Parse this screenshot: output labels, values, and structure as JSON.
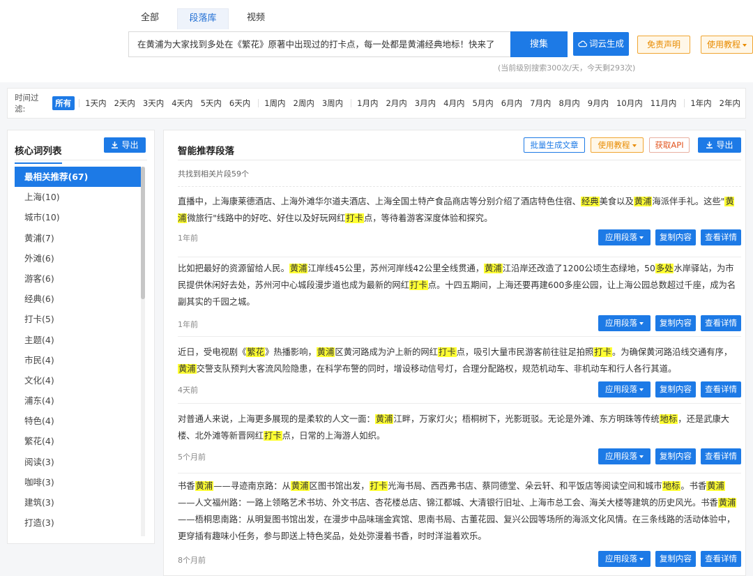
{
  "tabs": [
    {
      "label": "全部"
    },
    {
      "label": "段落库"
    },
    {
      "label": "视频"
    }
  ],
  "search": {
    "value": "在黄浦为大家找到多处在《繁花》原著中出现过的打卡点，每一处都是黄浦经典地标！快来了",
    "button": "搜集",
    "cloud_button": "词云生成",
    "disclaimer": "免责声明",
    "tutorial": "使用教程",
    "quota": "(当前级别搜索300次/天，今天剩293次)"
  },
  "filter": {
    "label": "时间过滤:",
    "options": [
      "所有",
      "1天内",
      "2天内",
      "3天内",
      "4天内",
      "5天内",
      "6天内",
      "1周内",
      "2周内",
      "3周内",
      "1月内",
      "2月内",
      "3月内",
      "4月内",
      "5月内",
      "6月内",
      "7月内",
      "8月内",
      "9月内",
      "10月内",
      "11月内",
      "1年内",
      "2年内"
    ]
  },
  "left": {
    "title": "核心词列表",
    "export": "导出",
    "keywords": [
      "最相关推荐(67)",
      "上海(10)",
      "城市(10)",
      "黄浦(7)",
      "外滩(6)",
      "游客(6)",
      "经典(6)",
      "打卡(5)",
      "主题(4)",
      "市民(4)",
      "文化(4)",
      "浦东(4)",
      "特色(4)",
      "繁花(4)",
      "阅读(3)",
      "咖啡(3)",
      "建筑(3)",
      "打造(3)"
    ]
  },
  "right": {
    "title": "智能推荐段落",
    "batch": "批量生成文章",
    "tutorial": "使用教程",
    "api": "获取API",
    "export": "导出",
    "count": "共找到相关片段59个",
    "actions": {
      "apply": "应用段落",
      "copy": "复制内容",
      "detail": "查看详情"
    },
    "cards": [
      {
        "time": "1年前",
        "segments": [
          {
            "t": "直播中，上海康莱德酒店、上海外滩华尔道夫酒店、上海全国土特产食品商店等分别介绍了酒店特色住宿、"
          },
          {
            "t": "经典",
            "h": true
          },
          {
            "t": "美食以及"
          },
          {
            "t": "黄浦",
            "h": true
          },
          {
            "t": "海派伴手礼。这些\""
          },
          {
            "t": "黄浦",
            "h": true
          },
          {
            "t": "微旅行\"线路中的好吃、好住以及好玩网红"
          },
          {
            "t": "打卡",
            "h": true
          },
          {
            "t": "点，等待着游客深度体验和探究。"
          }
        ]
      },
      {
        "time": "1年前",
        "segments": [
          {
            "t": "比如把最好的资源留给人民。"
          },
          {
            "t": "黄浦",
            "h": true
          },
          {
            "t": "江岸线45公里，苏州河岸线42公里全线贯通，"
          },
          {
            "t": "黄浦",
            "h": true
          },
          {
            "t": "江沿岸还改造了1200公顷生态绿地，50"
          },
          {
            "t": "多处",
            "h": true
          },
          {
            "t": "水岸驿站，为市民提供休闲好去处，苏州河中心城段漫步道也成为最新的网红"
          },
          {
            "t": "打卡",
            "h": true
          },
          {
            "t": "点。十四五期间，上海还要再建600多座公园，让上海公园总数超过千座，成为名副其实的千园之城。"
          }
        ]
      },
      {
        "time": "4天前",
        "segments": [
          {
            "t": "近日，受电视剧《"
          },
          {
            "t": "繁花",
            "h": true
          },
          {
            "t": "》热播影响，"
          },
          {
            "t": "黄浦",
            "h": true
          },
          {
            "t": "区黄河路成为沪上新的网红"
          },
          {
            "t": "打卡",
            "h": true
          },
          {
            "t": "点，吸引大量市民游客前往驻足拍照"
          },
          {
            "t": "打卡",
            "h": true
          },
          {
            "t": "。为确保黄河路沿线交通有序，"
          },
          {
            "t": "黄浦",
            "h": true
          },
          {
            "t": "交警支队预判大客流风险隐患，在科学布警的同时，增设移动信号灯，合理分配路权，规范机动车、非机动车和行人各行其道。"
          }
        ]
      },
      {
        "time": "5个月前",
        "segments": [
          {
            "t": "对普通人来说，上海更多展现的是柔软的人文一面："
          },
          {
            "t": "黄浦",
            "h": true
          },
          {
            "t": "江畔，万家灯火；梧桐树下，光影斑驳。无论是外滩、东方明珠等传统"
          },
          {
            "t": "地标",
            "h": true
          },
          {
            "t": "，还是武康大楼、北外滩等新晋网红"
          },
          {
            "t": "打卡",
            "h": true
          },
          {
            "t": "点，日常的上海游人如织。"
          }
        ]
      },
      {
        "time": "8个月前",
        "segments": [
          {
            "t": "书香"
          },
          {
            "t": "黄浦",
            "h": true
          },
          {
            "t": "——寻迹南京路：从"
          },
          {
            "t": "黄浦",
            "h": true
          },
          {
            "t": "区图书馆出发，"
          },
          {
            "t": "打卡",
            "h": true
          },
          {
            "t": "光海书局、西西弗书店、蔡同德堂、朵云轩、和平饭店等阅读空间和城市"
          },
          {
            "t": "地标",
            "h": true
          },
          {
            "t": "。书香"
          },
          {
            "t": "黄浦",
            "h": true
          },
          {
            "t": "——人文福州路：一路上领略艺术书坊、外文书店、杏花楼总店、锦江都城、大清银行旧址、上海市总工会、海关大楼等建筑的历史风光。书香"
          },
          {
            "t": "黄浦",
            "h": true
          },
          {
            "t": "——梧桐思南路：从明复图书馆出发，在漫步中品味瑞金宾馆、思南书局、古董花园、复兴公园等场所的海派文化风情。在三条线路的活动体验中，更穿插有趣味小任务，参与即送上特色奖品，处处弥漫着书香，时时洋溢着欢乐。"
          }
        ]
      }
    ]
  }
}
